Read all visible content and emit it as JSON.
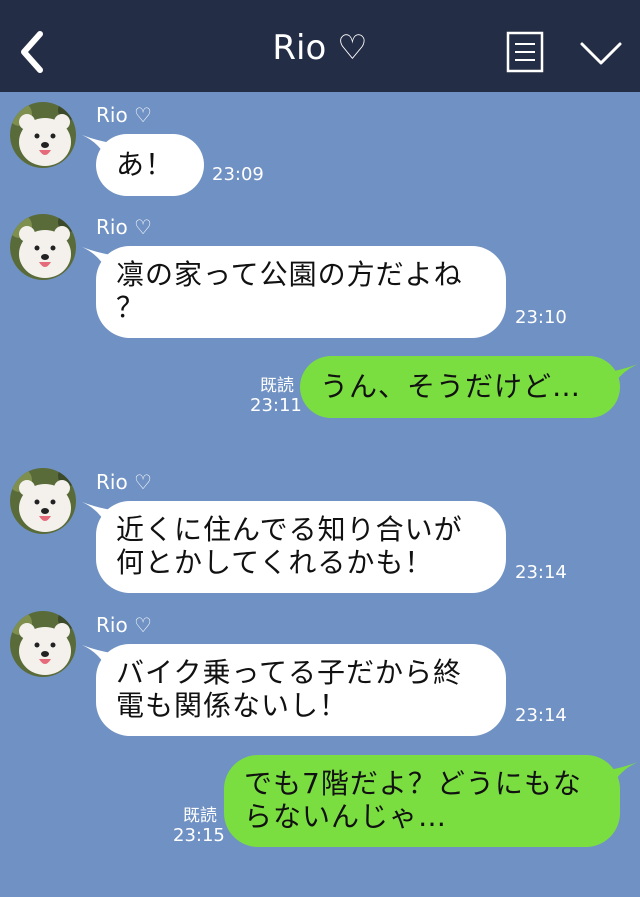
{
  "header": {
    "title": "Rio ♡",
    "back_icon": "chevron-left-icon",
    "menu_icon": "menu-list-icon",
    "more_icon": "chevron-down-icon"
  },
  "colors": {
    "header_bg": "#232d45",
    "chat_bg": "#7091c3",
    "incoming_bubble": "#ffffff",
    "outgoing_bubble": "#7bde40"
  },
  "messages": [
    {
      "sender": "Rio ♡",
      "lines": [
        "あ！"
      ],
      "time": "23:09"
    },
    {
      "sender": "Rio ♡",
      "lines": [
        "凛の家って公園の方だよね",
        "？"
      ],
      "time": "23:10"
    },
    {
      "read": "既読",
      "lines": [
        "うん、そうだけど…"
      ],
      "time": "23:11"
    },
    {
      "sender": "Rio ♡",
      "lines": [
        "近くに住んでる知り合いが",
        "何とかしてくれるかも！"
      ],
      "time": "23:14"
    },
    {
      "sender": "Rio ♡",
      "lines": [
        "バイク乗ってる子だから終",
        "電も関係ないし！"
      ],
      "time": "23:14"
    },
    {
      "read": "既読",
      "lines": [
        "でも7階だよ？どうにもな",
        "らないんじゃ…"
      ],
      "time": "23:15"
    }
  ]
}
